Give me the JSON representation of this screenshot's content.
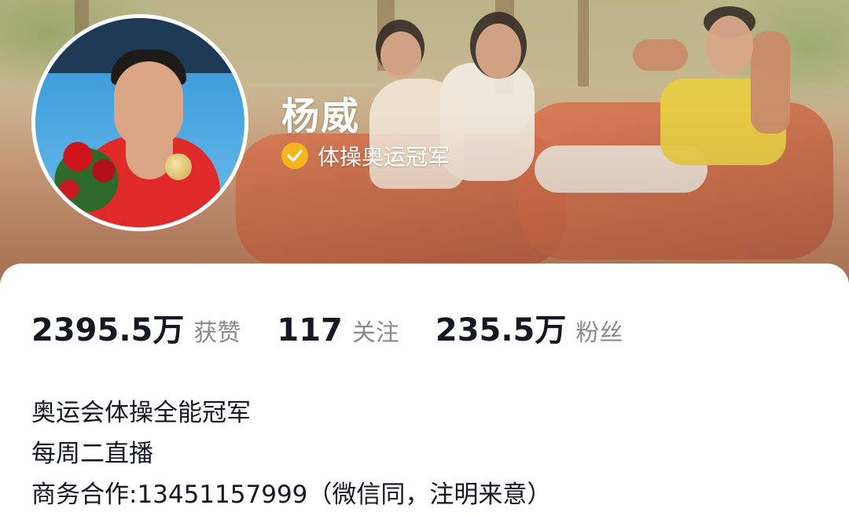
{
  "profile": {
    "name": "杨威",
    "verification": "体操奥运冠军"
  },
  "stats": [
    {
      "value": "2395.5万",
      "label": "获赞"
    },
    {
      "value": "117",
      "label": "关注"
    },
    {
      "value": "235.5万",
      "label": "粉丝"
    }
  ],
  "bio": {
    "lines": [
      "奥运会体操全能冠军",
      "每周二直播",
      "商务合作:13451157999（微信同，注明来意）"
    ]
  },
  "icons": {
    "verify": "verified-check-icon"
  },
  "colors": {
    "verify_badge": "#f6b41e",
    "primary_text": "#161823",
    "secondary_text": "#8a8b91"
  }
}
